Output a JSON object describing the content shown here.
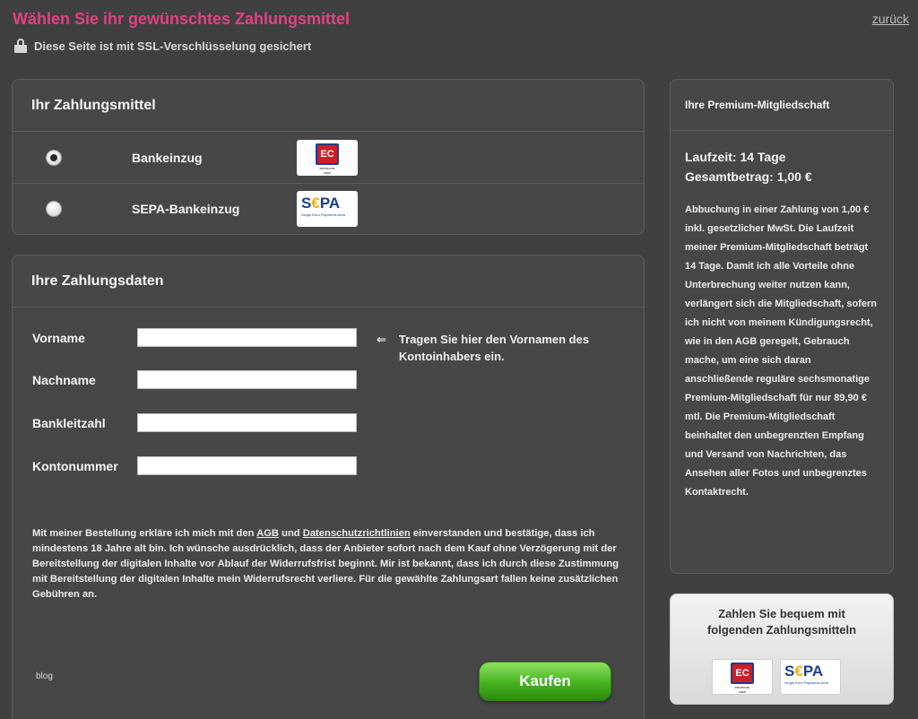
{
  "header": {
    "title": "Wählen Sie ihr gewünschtes Zahlungsmittel",
    "back_link": "zurück",
    "ssl_notice": "Diese Seite ist mit SSL-Verschlüsselung gesichert"
  },
  "methods": {
    "title": "Ihr Zahlungsmittel",
    "options": [
      {
        "label": "Bankeinzug",
        "selected": true,
        "logo": "ec-logo"
      },
      {
        "label": "SEPA-Bankeinzug",
        "selected": false,
        "logo": "sepa-logo"
      }
    ]
  },
  "payment_data": {
    "title": "Ihre Zahlungsdaten",
    "fields": [
      {
        "label": "Vorname",
        "value": ""
      },
      {
        "label": "Nachname",
        "value": ""
      },
      {
        "label": "Bankleitzahl",
        "value": ""
      },
      {
        "label": "Kontonummer",
        "value": ""
      }
    ],
    "hint_arrow": "⇐",
    "hint": "Tragen Sie hier den Vornamen des Kontoinhabers ein.",
    "legal_pre": "Mit meiner Bestellung erkläre ich mich mit den ",
    "legal_agb": "AGB",
    "legal_and": " und ",
    "legal_privacy": "Datenschutzrichtlinien",
    "legal_post": " einverstanden und bestätige, dass ich mindestens 18 Jahre alt bin. Ich wünsche ausdrücklich, dass der Anbieter sofort nach dem Kauf ohne Verzögerung mit der Bereitstellung der digitalen Inhalte vor Ablauf der Widerrufsfrist beginnt. Mir ist bekannt, dass ich durch diese Zustimmung mit Bereitstellung der digitalen Inhalte mein Widerrufsrecht verliere. Für die gewählte Zahlungsart fallen keine zusätzlichen Gebühren an.",
    "buy_label": "Kaufen",
    "blog_tag": "blog"
  },
  "premium": {
    "title": "Ihre Premium-Mitgliedschaft",
    "term": "Laufzeit: 14 Tage",
    "total": "Gesamtbetrag: 1,00 €",
    "description": "Abbuchung in einer Zahlung von 1,00 € inkl. gesetzlicher MwSt. Die Laufzeit meiner Premium-Mitgliedschaft beträgt 14 Tage. Damit ich alle Vorteile ohne Unterbrechung weiter nutzen kann, verlängert sich die Mitgliedschaft, sofern ich nicht von meinem Kündigungsrecht, wie in den AGB geregelt, Gebrauch mache, um eine sich daran anschließende reguläre sechsmonatige Premium-Mitgliedschaft für nur 89,90 € mtl. Die Premium-Mitgliedschaft beinhaltet den unbegrenzten Empfang und Versand von Nachrichten, das Ansehen aller Fotos und unbegrenztes Kontaktrecht."
  },
  "pay_box": {
    "title_line1": "Zahlen Sie bequem mit",
    "title_line2": "folgenden Zahlungsmitteln"
  },
  "logos": {
    "ec_mark": "EC",
    "ec_caption": "electronic cash",
    "sepa_pre": "S",
    "sepa_euro": "€",
    "sepa_post": "PA",
    "sepa_caption": "Single Euro Payments Area"
  },
  "colors": {
    "title_pink": "#e0427f",
    "background": "#404040",
    "buy_green": "#45b21f"
  }
}
